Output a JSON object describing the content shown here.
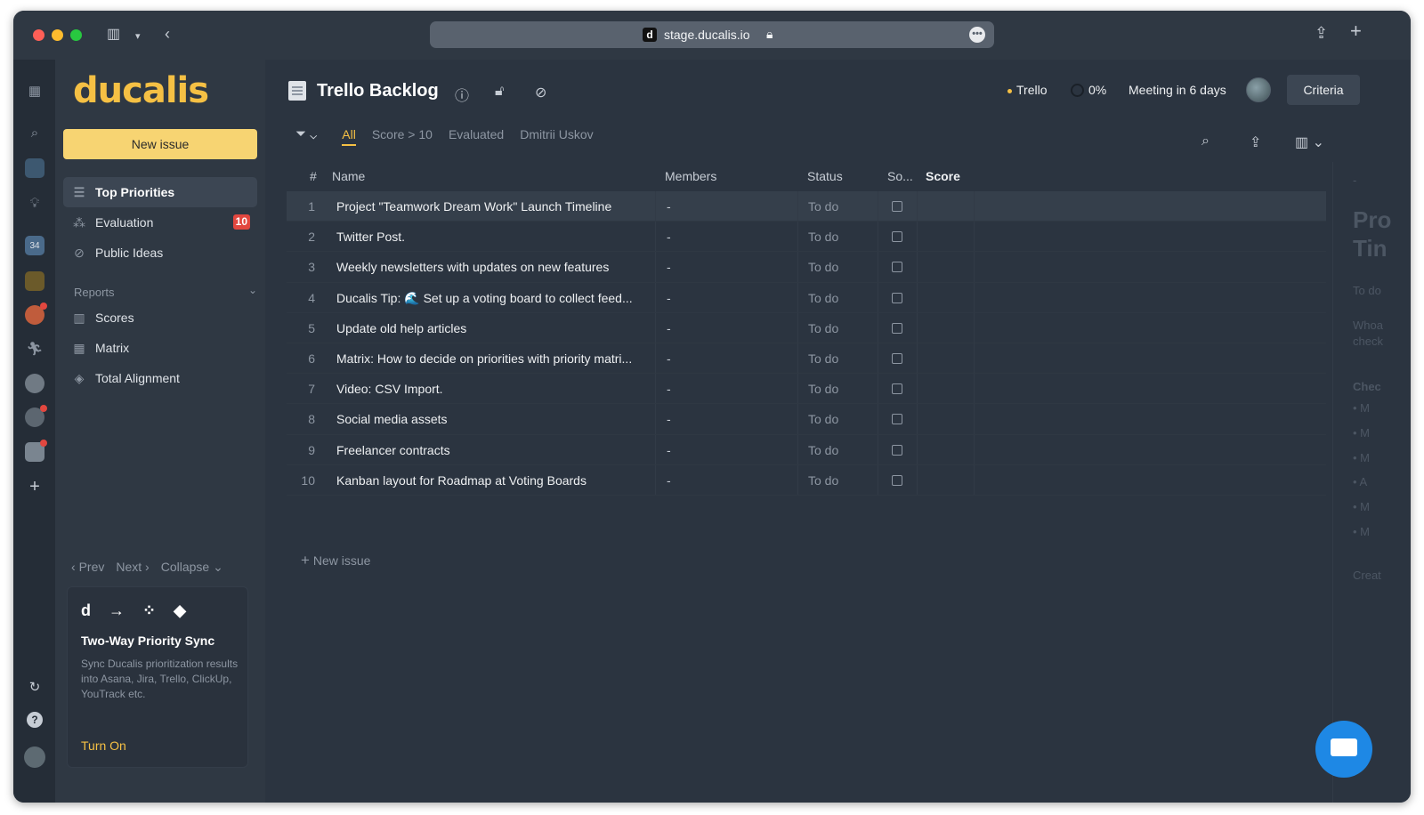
{
  "browser": {
    "url": "stage.ducalis.io",
    "favicon_letter": "d"
  },
  "sidebar": {
    "logo": "ducalis",
    "new_issue_label": "New issue",
    "items": [
      {
        "label": "Top Priorities",
        "icon": "list-icon",
        "active": true
      },
      {
        "label": "Evaluation",
        "icon": "nodes-icon",
        "badge": "10"
      },
      {
        "label": "Public Ideas",
        "icon": "no-bulb-icon"
      }
    ],
    "reports_label": "Reports",
    "reports": [
      {
        "label": "Scores",
        "icon": "columns-icon"
      },
      {
        "label": "Matrix",
        "icon": "grid-icon"
      },
      {
        "label": "Total Alignment",
        "icon": "layers-icon"
      }
    ],
    "pager": {
      "prev": "Prev",
      "next": "Next",
      "collapse": "Collapse"
    },
    "promo": {
      "title": "Two-Way Priority Sync",
      "text": "Sync Ducalis prioritization results into Asana, Jira, Trello, ClickUp, YouTrack etc.",
      "link": "Turn On"
    }
  },
  "header": {
    "title": "Trello Backlog",
    "source": "Trello",
    "progress": "0%",
    "meeting": "Meeting in 6 days",
    "criteria_label": "Criteria"
  },
  "filters": {
    "tabs": [
      "All",
      "Score > 10",
      "Evaluated",
      "Dmitrii Uskov"
    ],
    "active_tab": "All"
  },
  "table": {
    "columns": [
      "#",
      "Name",
      "Members",
      "Status",
      "So...",
      "Score"
    ],
    "rows": [
      {
        "num": "1",
        "name": "Project \"Teamwork Dream Work\" Launch Timeline",
        "members": "-",
        "status": "To do"
      },
      {
        "num": "2",
        "name": "Twitter Post.",
        "members": "-",
        "status": "To do"
      },
      {
        "num": "3",
        "name": "Weekly newsletters with updates on new features",
        "members": "-",
        "status": "To do"
      },
      {
        "num": "4",
        "name": "Ducalis Tip: 🌊 Set up a voting board to collect feed...",
        "members": "-",
        "status": "To do"
      },
      {
        "num": "5",
        "name": "Update old help articles",
        "members": "-",
        "status": "To do"
      },
      {
        "num": "6",
        "name": "Matrix: How to decide on priorities with priority matri...",
        "members": "-",
        "status": "To do"
      },
      {
        "num": "7",
        "name": "Video: CSV Import.",
        "members": "-",
        "status": "To do"
      },
      {
        "num": "8",
        "name": "Social media assets",
        "members": "-",
        "status": "To do"
      },
      {
        "num": "9",
        "name": "Freelancer contracts",
        "members": "-",
        "status": "To do"
      },
      {
        "num": "10",
        "name": "Kanban layout for Roadmap at Voting Boards",
        "members": "-",
        "status": "To do"
      }
    ],
    "new_issue_label": "New issue"
  },
  "right_panel": {
    "dash": "-",
    "title_line1": "Pro",
    "title_line2": "Tin",
    "status": "To do",
    "desc1": "Whoa",
    "desc2": "check",
    "section": "Chec",
    "bullets": [
      "M",
      "M",
      "M",
      "A",
      "M",
      "M"
    ],
    "footer": "Creat"
  },
  "colors": {
    "accent": "#f5c044",
    "badge": "#e2473f",
    "chat": "#1e88e5"
  }
}
